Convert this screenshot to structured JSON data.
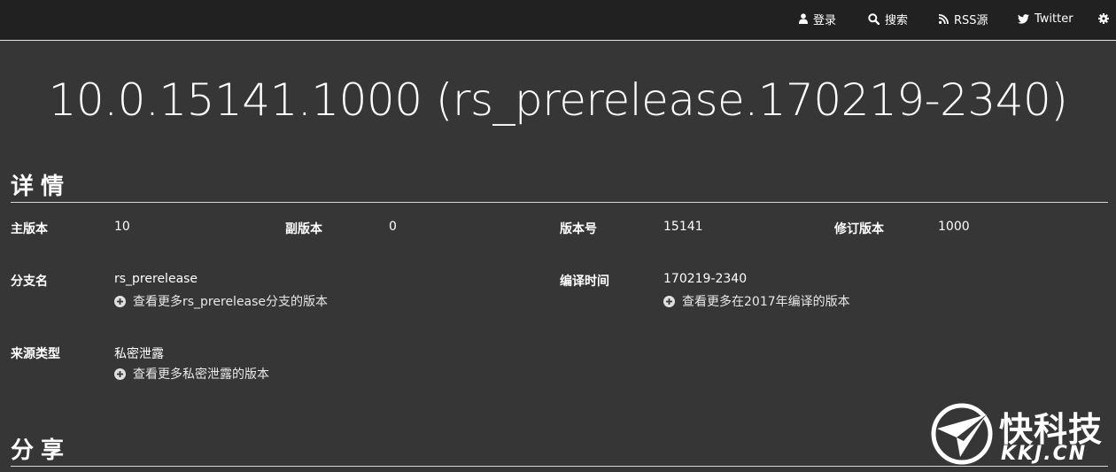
{
  "nav": {
    "login_label": "登录",
    "search_label": "搜索",
    "rss_label": "RSS源",
    "twitter_label": "Twitter",
    "icons": [
      "user-icon",
      "search-icon",
      "rss-icon",
      "twitter-icon",
      "gear-icon"
    ]
  },
  "page": {
    "title": "10.0.15141.1000 (rs_prerelease.170219-2340)"
  },
  "details": {
    "heading": "详情",
    "major_label": "主版本",
    "major_value": "10",
    "minor_label": "副版本",
    "minor_value": "0",
    "build_label": "版本号",
    "build_value": "15141",
    "revision_label": "修订版本",
    "revision_value": "1000",
    "branch_label": "分支名",
    "branch_value": "rs_prerelease",
    "branch_more": "查看更多rs_prerelease分支的版本",
    "compiled_label": "编译时间",
    "compiled_value": "170219-2340",
    "compiled_more": "查看更多在2017年编译的版本",
    "source_label": "来源类型",
    "source_value": "私密泄露",
    "source_more": "查看更多私密泄露的版本"
  },
  "share": {
    "heading": "分享"
  },
  "watermark": {
    "text_cn": "快科技",
    "text_en": "KKJ.CN"
  },
  "colors": {
    "background": "#363636",
    "topbar": "#212121",
    "text": "#ffffff",
    "rule": "#d6d6d6"
  }
}
